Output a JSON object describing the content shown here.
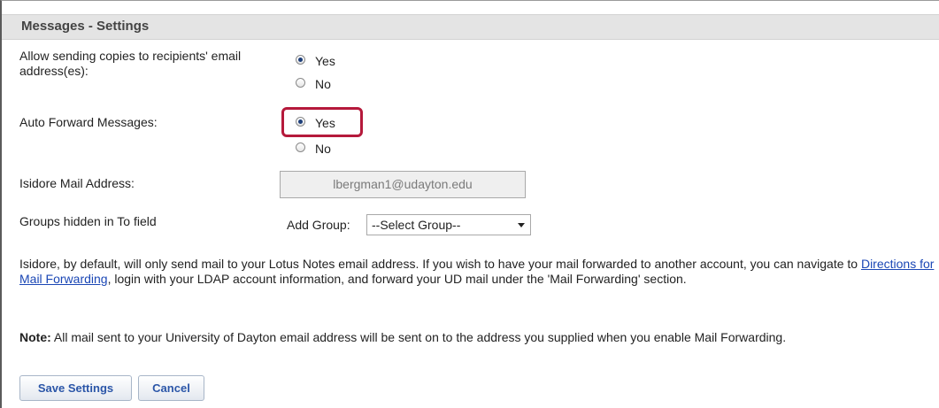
{
  "header": {
    "title": "Messages - Settings"
  },
  "allow_copies": {
    "label": "Allow sending copies to recipients' email address(es):",
    "options": [
      {
        "label": "Yes",
        "selected": true
      },
      {
        "label": "No",
        "selected": false
      }
    ]
  },
  "auto_forward": {
    "label": "Auto Forward Messages:",
    "options": [
      {
        "label": "Yes",
        "selected": true
      },
      {
        "label": "No",
        "selected": false
      }
    ]
  },
  "mail_address": {
    "label": "Isidore Mail Address:",
    "value": "lbergman1@udayton.edu"
  },
  "groups": {
    "label": "Groups hidden in To field",
    "add_label": "Add Group:",
    "selected": "--Select Group--"
  },
  "info": {
    "text_before": "Isidore, by default, will only send mail to your Lotus Notes email address. If you wish to have your mail forwarded to another account, you can navigate to ",
    "link_text": "Directions for Mail Forwarding",
    "text_after": ", login with your LDAP account information, and forward your UD mail under the 'Mail Forwarding' section."
  },
  "note": {
    "bold": "Note:",
    "text": " All mail sent to your University of Dayton email address will be sent on to the address you supplied when you enable Mail Forwarding."
  },
  "buttons": {
    "save": "Save Settings",
    "cancel": "Cancel"
  },
  "colors": {
    "highlight": "#b5193b",
    "link": "#1b47b5",
    "button_text": "#2b56a8"
  }
}
